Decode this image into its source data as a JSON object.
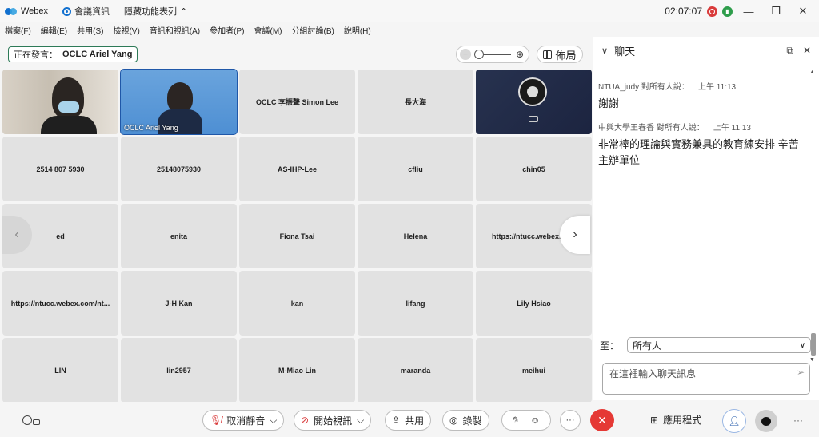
{
  "titlebar": {
    "app": "Webex",
    "meeting_info": "會議資訊",
    "hide_menu": "隱藏功能表列",
    "time": "02:07:07",
    "minimize": "—",
    "restore": "❐",
    "close": "✕"
  },
  "menu": [
    "檔案(F)",
    "編輯(E)",
    "共用(S)",
    "檢視(V)",
    "音訊和視訊(A)",
    "參加者(P)",
    "會議(M)",
    "分組討論(B)",
    "說明(H)"
  ],
  "speaker": {
    "label": "正在發言：",
    "name": "OCLC Ariel Yang"
  },
  "layout_label": "佈局",
  "tiles": [
    {
      "name": "",
      "kind": "video-room"
    },
    {
      "name": "OCLC Ariel Yang",
      "kind": "video-blue"
    },
    {
      "name": "OCLC 李振聲 Simon Lee",
      "kind": "name"
    },
    {
      "name": "長大海",
      "kind": "name"
    },
    {
      "name": "",
      "kind": "obs"
    },
    {
      "name": "2514 807 5930",
      "kind": "name"
    },
    {
      "name": "25148075930",
      "kind": "name"
    },
    {
      "name": "AS-IHP-Lee",
      "kind": "name"
    },
    {
      "name": "cfliu",
      "kind": "name"
    },
    {
      "name": "chin05",
      "kind": "name"
    },
    {
      "name": "ed",
      "kind": "name"
    },
    {
      "name": "enita",
      "kind": "name"
    },
    {
      "name": "Fiona Tsai",
      "kind": "name"
    },
    {
      "name": "Helena",
      "kind": "name"
    },
    {
      "name": "https://ntucc.webex.com",
      "kind": "name"
    },
    {
      "name": "https://ntucc.webex.com/nt...",
      "kind": "name"
    },
    {
      "name": "J-H Kan",
      "kind": "name"
    },
    {
      "name": "kan",
      "kind": "name"
    },
    {
      "name": "lifang",
      "kind": "name"
    },
    {
      "name": "Lily Hsiao",
      "kind": "name"
    },
    {
      "name": "LIN",
      "kind": "name"
    },
    {
      "name": "lin2957",
      "kind": "name"
    },
    {
      "name": "M-Miao Lin",
      "kind": "name"
    },
    {
      "name": "maranda",
      "kind": "name"
    },
    {
      "name": "meihui",
      "kind": "name"
    }
  ],
  "chat": {
    "title": "聊天",
    "messages": [
      {
        "sender": "NTUA_judy 對所有人說：",
        "time": "上午 11:13",
        "text": "謝謝"
      },
      {
        "sender": "中興大學王春香 對所有人說：",
        "time": "上午 11:13",
        "text": "非常棒的理論與實務兼具的教育練安排 辛苦主辦單位"
      }
    ],
    "to_label": "至：",
    "to_value": "所有人",
    "input_placeholder": "在這裡輸入聊天訊息"
  },
  "controls": {
    "unmute": "取消靜音",
    "start_video": "開始視訊",
    "share": "共用",
    "record": "錄製",
    "apps": "應用程式"
  }
}
